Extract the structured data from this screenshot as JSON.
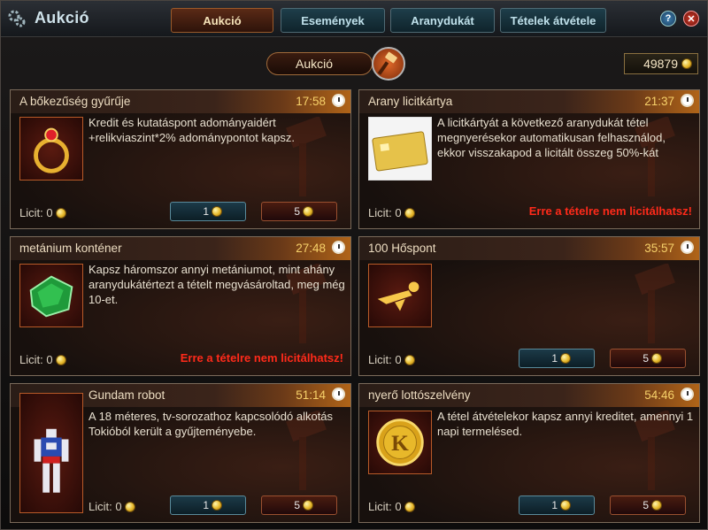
{
  "window": {
    "title": "Aukció"
  },
  "tabs": [
    {
      "label": "Aukció",
      "active": true
    },
    {
      "label": "Események"
    },
    {
      "label": "Aranydukát"
    },
    {
      "label": "Tételek átvétele"
    }
  ],
  "header": {
    "section_label": "Aukció",
    "gold_amount": "49879"
  },
  "cards": [
    {
      "title": "A bőkezűség gyűrűje",
      "timer": "17:58",
      "icon": "gold-ring-icon",
      "description": "Kredit és kutatáspont adományaidért +relikviaszint*2% adománypontot kapsz.",
      "licit_label": "Licit: 0",
      "bid_small": "1",
      "bid_large": "5",
      "warning": ""
    },
    {
      "title": "Arany licitkártya",
      "timer": "21:37",
      "icon": "gold-card-icon",
      "description": "A licitkártyát a következő aranydukát tétel megnyerésekor automatikusan felhasználod, ekkor visszakapod a licitált összeg 50%-kát",
      "licit_label": "Licit: 0",
      "bid_small": "",
      "bid_large": "",
      "warning": "Erre a tételre nem licitálhatsz!"
    },
    {
      "title": "metánium konténer",
      "timer": "27:48",
      "icon": "green-crystal-icon",
      "description": "Kapsz háromszor annyi metániumot, mint ahány aranydukátértezt a tételt megvásároltad, meg még 10-et.",
      "licit_label": "Licit: 0",
      "bid_small": "",
      "bid_large": "",
      "warning": "Erre a tételre nem licitálhatsz!"
    },
    {
      "title": "100 Hőspont",
      "timer": "35:57",
      "icon": "hero-flying-icon",
      "description": "",
      "licit_label": "Licit: 0",
      "bid_small": "1",
      "bid_large": "5",
      "warning": ""
    },
    {
      "title": "Gundam robot",
      "timer": "51:14",
      "icon": "gundam-robot-icon",
      "description": "A 18 méteres, tv-sorozathoz kapcsolódó alkotás Tokióból került a gyűjteményebe.",
      "licit_label": "Licit: 0",
      "bid_small": "1",
      "bid_large": "5",
      "warning": ""
    },
    {
      "title": "nyerő lottószelvény",
      "timer": "54:46",
      "icon": "k-coin-icon",
      "description": "A tétel átvételekor kapsz annyi kreditet, amennyi 1 napi termelésed.",
      "licit_label": "Licit: 0",
      "bid_small": "1",
      "bid_large": "5",
      "warning": ""
    }
  ],
  "colors": {
    "accent_orange": "#b06418",
    "timer_gold": "#f7d16a",
    "warning_red": "#ff2a1a",
    "tab_teal": "#1e3e4a"
  }
}
